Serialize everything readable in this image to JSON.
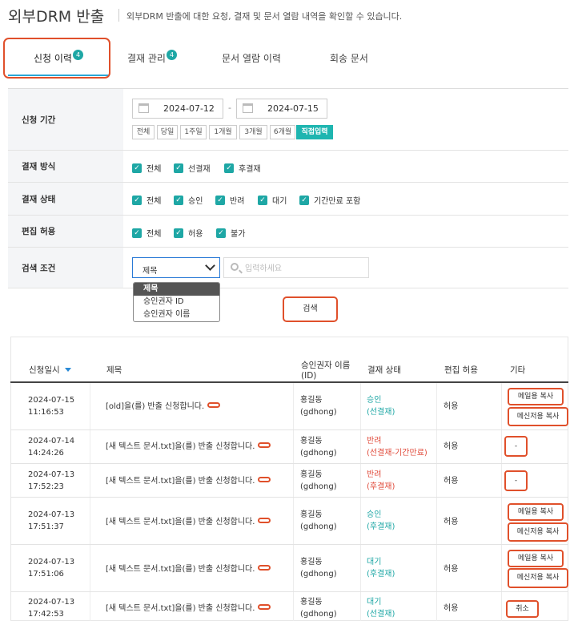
{
  "header": {
    "title": "외부DRM 반출",
    "description": "외부DRM 반출에 대한 요청, 결재 및 문서 열람 내역을 확인할 수 있습니다."
  },
  "tabs": [
    {
      "label": "신청 이력",
      "badge": "4"
    },
    {
      "label": "결재 관리",
      "badge": "4"
    },
    {
      "label": "문서 열람 이력",
      "badge": ""
    },
    {
      "label": "회송 문서",
      "badge": ""
    }
  ],
  "filters": {
    "period": {
      "label": "신청 기간",
      "start": "2024-07-12",
      "end": "2024-07-15",
      "separator": "-",
      "buttons": [
        "전체",
        "당일",
        "1주일",
        "1개월",
        "3개월",
        "6개월",
        "직접입력"
      ],
      "selected": "직접입력"
    },
    "approval_method": {
      "label": "결재 방식",
      "options": [
        "전체",
        "선결재",
        "후결재"
      ]
    },
    "approval_status": {
      "label": "결재 상태",
      "options": [
        "전체",
        "승인",
        "반려",
        "대기",
        "기간만료 포함"
      ]
    },
    "edit_permission": {
      "label": "편집 허용",
      "options": [
        "전체",
        "허용",
        "불가"
      ]
    },
    "search": {
      "label": "검색 조건",
      "selected": "제목",
      "placeholder": "입력하세요",
      "dropdown": [
        "제목",
        "승인권자 ID",
        "승인권자 이름"
      ]
    },
    "search_button": "검색"
  },
  "table": {
    "headers": {
      "date": "신청일시",
      "title": "제목",
      "approver": "승인권자 이름",
      "approver_sub": "(ID)",
      "status": "결재 상태",
      "edit": "편집 허용",
      "etc": "기타"
    },
    "rows": [
      {
        "date": "2024-07-15",
        "time": "11:16:53",
        "title": "[old]을(를) 반출 신청합니다.",
        "approver": "홍길동",
        "approver_id": "(gdhong)",
        "status": "승인",
        "status_sub": "(선결재)",
        "status_type": "approved",
        "edit": "허용",
        "actions": [
          "메일용 복사",
          "메신저용 복사"
        ]
      },
      {
        "date": "2024-07-14",
        "time": "14:24:26",
        "title": "[새 텍스트 문서.txt]을(를) 반출 신청합니다.",
        "approver": "홍길동",
        "approver_id": "(gdhong)",
        "status": "반려",
        "status_sub": "(선결재-기간만료)",
        "status_type": "rejected",
        "edit": "허용",
        "actions": [
          "-"
        ]
      },
      {
        "date": "2024-07-13",
        "time": "17:52:23",
        "title": "[새 텍스트 문서.txt]을(를) 반출 신청합니다.",
        "approver": "홍길동",
        "approver_id": "(gdhong)",
        "status": "반려",
        "status_sub": "(후결재)",
        "status_type": "rejected",
        "edit": "허용",
        "actions": [
          "-"
        ]
      },
      {
        "date": "2024-07-13",
        "time": "17:51:37",
        "title": "[새 텍스트 문서.txt]을(를) 반출 신청합니다.",
        "approver": "홍길동",
        "approver_id": "(gdhong)",
        "status": "승인",
        "status_sub": "(후결재)",
        "status_type": "approved",
        "edit": "허용",
        "actions": [
          "메일용 복사",
          "메신저용 복사"
        ]
      },
      {
        "date": "2024-07-13",
        "time": "17:51:06",
        "title": "[새 텍스트 문서.txt]을(를) 반출 신청합니다.",
        "approver": "홍길동",
        "approver_id": "(gdhong)",
        "status": "대기",
        "status_sub": "(후결재)",
        "status_type": "pending",
        "edit": "허용",
        "actions": [
          "메일용 복사",
          "메신저용 복사"
        ]
      },
      {
        "date": "2024-07-13",
        "time": "17:42:53",
        "title": "[새 텍스트 문서.txt]을(를) 반출 신청합니다.",
        "approver": "홍길동",
        "approver_id": "(gdhong)",
        "status": "대기",
        "status_sub": "(선결재)",
        "status_type": "pending",
        "edit": "허용",
        "actions": [
          "취소"
        ]
      }
    ]
  },
  "colors": {
    "accent": "#1ea7a5",
    "highlight": "#e0502b",
    "rejected": "#e04a3a",
    "tab_underline": "#2aa7d6"
  }
}
